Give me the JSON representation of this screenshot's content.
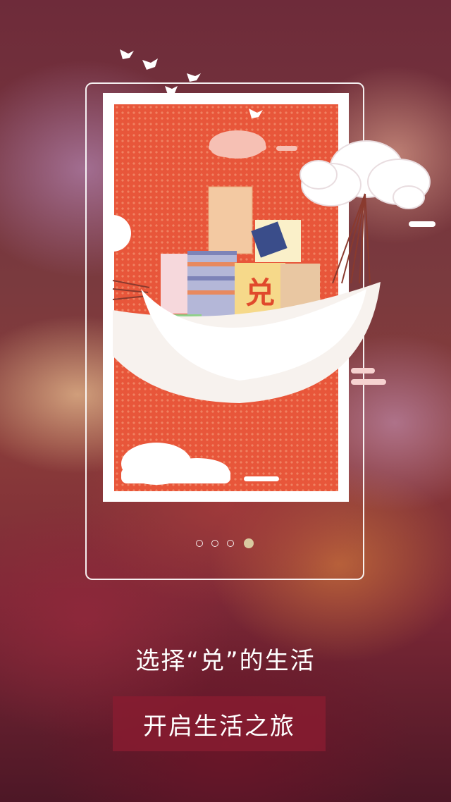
{
  "onboarding": {
    "headline": "选择“兑”的生活",
    "cta_label": "开启生活之旅",
    "illustration": {
      "block_char": "兑",
      "colors": {
        "poster_bg": "#e8563a",
        "boat": "#f7f2ee",
        "block_yellow": "#f6d98a",
        "block_char": "#e04a2c",
        "block_purple": "#a58bd8",
        "block_orange": "#f3b56a",
        "block_green": "#8fd08a"
      }
    },
    "pagination": {
      "total": 4,
      "current": 4
    }
  }
}
